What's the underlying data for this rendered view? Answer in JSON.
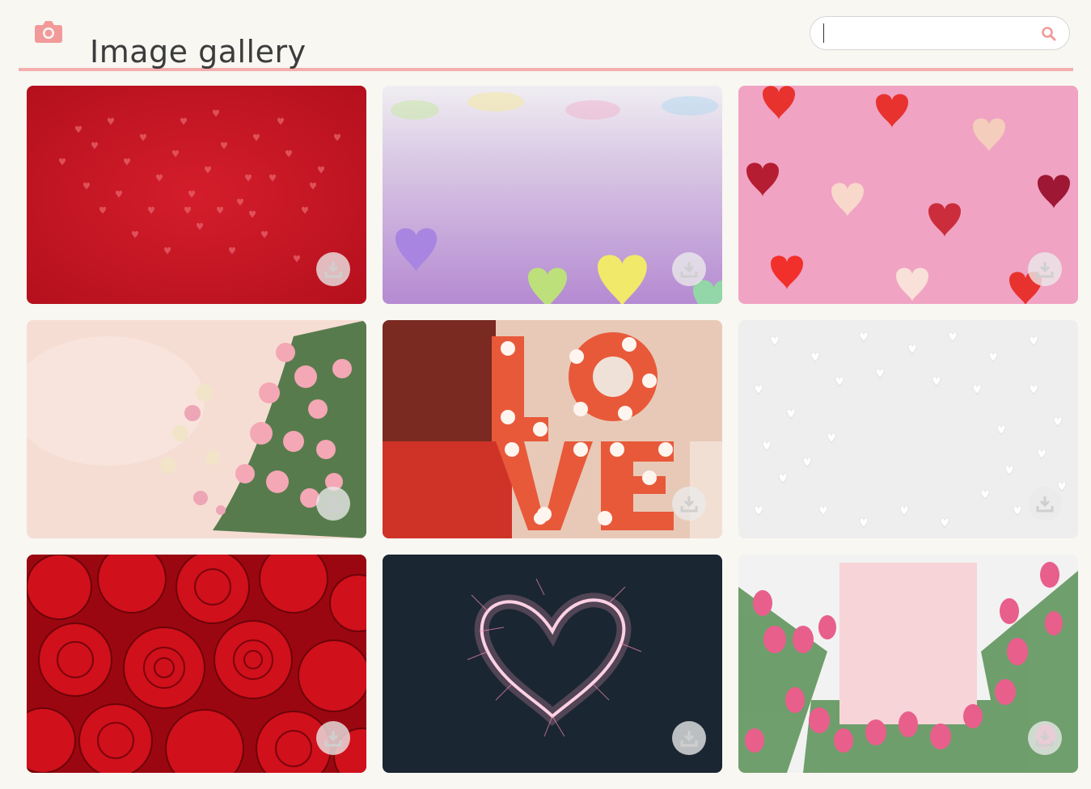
{
  "header": {
    "title": "Image gallery",
    "logo_icon": "camera-icon",
    "accent_color": "#f4aeae"
  },
  "search": {
    "value": "",
    "placeholder": "",
    "icon": "search-icon"
  },
  "gallery": {
    "download_icon": "download-icon",
    "images": [
      {
        "subject": "red-confetti-hearts"
      },
      {
        "subject": "candy-conversation-hearts"
      },
      {
        "subject": "paper-hearts-on-pink"
      },
      {
        "subject": "pink-roses-and-macarons"
      },
      {
        "subject": "love-marquee-letters"
      },
      {
        "subject": "white-candy-hearts"
      },
      {
        "subject": "red-roses"
      },
      {
        "subject": "sparkler-heart"
      },
      {
        "subject": "pink-tulips-with-card"
      }
    ]
  }
}
